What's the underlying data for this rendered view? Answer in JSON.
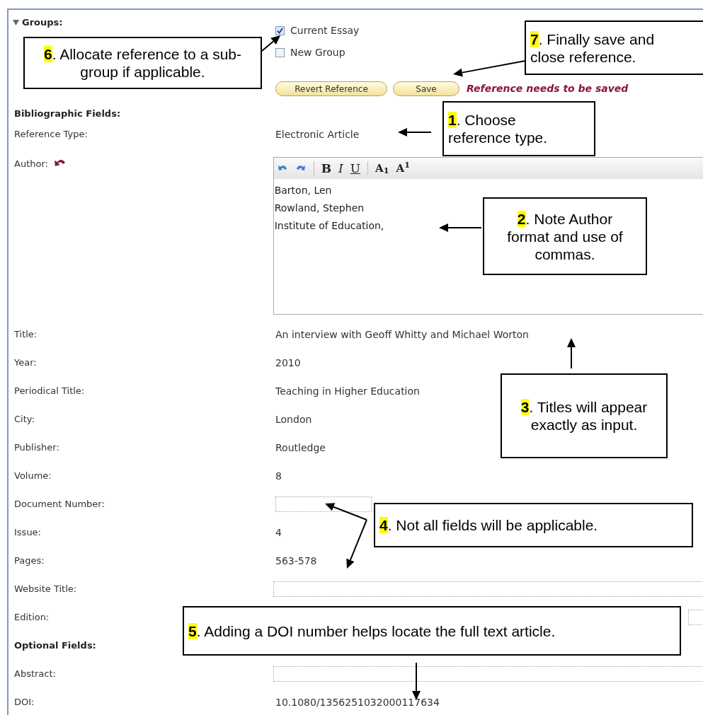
{
  "groups": {
    "label": "Groups:",
    "expanded": true,
    "items": [
      {
        "label": "Current Essay",
        "checked": true
      },
      {
        "label": "New Group",
        "checked": false
      }
    ]
  },
  "buttons": [
    "Revert Reference",
    "Save"
  ],
  "status_message": "Reference needs to be saved",
  "section_title": "Bibliographic Fields:",
  "fields": [
    {
      "kind": "text",
      "label": "Reference Type:",
      "value": "Electronic Article"
    },
    {
      "kind": "editor",
      "label": "Author:",
      "toolbar": [
        {
          "kind": "bold",
          "label": "B"
        },
        {
          "kind": "italic",
          "label": "I"
        },
        {
          "kind": "underline",
          "label": "U"
        },
        {
          "kind": "script",
          "label": "A$_{1}$"
        },
        {
          "kind": "script",
          "label": "A$^{1}$"
        }
      ],
      "lines": [
        "Barton, Len",
        "Rowland, Stephen",
        "Institute of Education,"
      ]
    },
    {
      "kind": "text",
      "label": "Title:",
      "value": "An interview with Geoff Whitty and Michael Worton"
    },
    {
      "kind": "text",
      "label": "Year:",
      "value": "2010"
    },
    {
      "kind": "text",
      "label": "Periodical Title:",
      "value": "Teaching in Higher Education"
    },
    {
      "kind": "text",
      "label": "City:",
      "value": "London"
    },
    {
      "kind": "text",
      "label": "Publisher:",
      "value": "Routledge"
    },
    {
      "kind": "text",
      "label": "Volume:",
      "value": "8"
    },
    {
      "kind": "input",
      "label": "Document Number:"
    },
    {
      "kind": "text",
      "label": "Issue:",
      "value": "4"
    },
    {
      "kind": "text",
      "label": "Pages:",
      "value": "563-578"
    },
    {
      "kind": "input",
      "label": "Website Title:"
    },
    {
      "kind": "input",
      "label": "Edition:"
    },
    {
      "kind": "heading",
      "label": "Optional Fields:"
    },
    {
      "kind": "input",
      "label": "Abstract:"
    },
    {
      "kind": "text",
      "label": "DOI:",
      "value": "10.1080/1356251032000117634"
    }
  ],
  "callouts": [
    {
      "number": "6",
      "text": ". Allocate reference to a sub-group if applicable."
    },
    {
      "number": "7",
      "text": ". Finally save and close reference."
    },
    {
      "number": "1",
      "text": ". Choose reference type."
    },
    {
      "number": "2",
      "text": ". Note Author format and use of commas."
    },
    {
      "number": "3",
      "text": ". Titles will appear exactly as input."
    },
    {
      "number": "4",
      "text": ". Not all fields will be applicable."
    },
    {
      "number": "5",
      "text": ". Adding a DOI number helps locate the full text article."
    }
  ]
}
